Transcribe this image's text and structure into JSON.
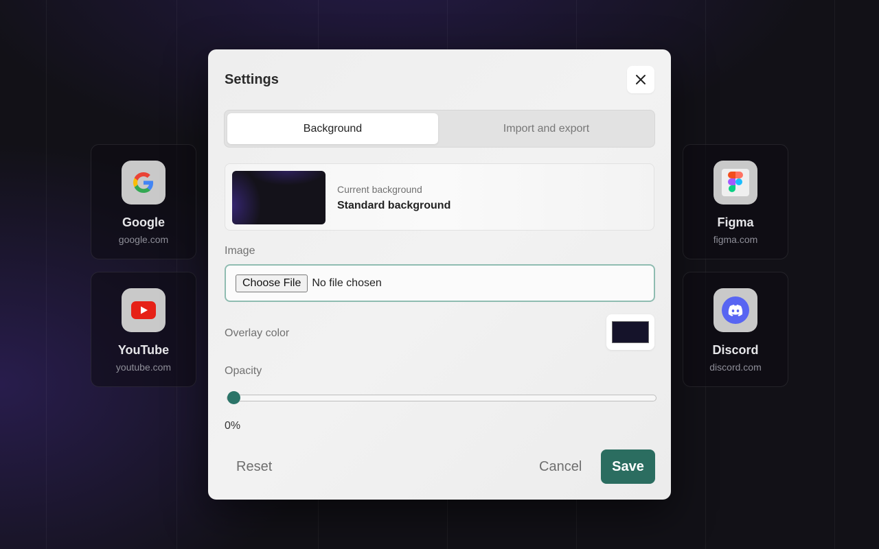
{
  "shortcuts": [
    {
      "name": "Google",
      "url": "google.com",
      "icon": "google-icon"
    },
    {
      "name": "YouTube",
      "url": "youtube.com",
      "icon": "youtube-icon"
    },
    {
      "name": "Figma",
      "url": "figma.com",
      "icon": "figma-icon"
    },
    {
      "name": "Discord",
      "url": "discord.com",
      "icon": "discord-icon"
    }
  ],
  "dialog": {
    "title": "Settings",
    "tabs": [
      {
        "label": "Background",
        "active": true
      },
      {
        "label": "Import and export",
        "active": false
      }
    ],
    "current_background": {
      "label": "Current background",
      "value": "Standard background"
    },
    "image": {
      "label": "Image",
      "button_label": "Choose File",
      "status": "No file chosen"
    },
    "overlay": {
      "label": "Overlay color",
      "color": "#15132a"
    },
    "opacity": {
      "label": "Opacity",
      "value": 0,
      "display": "0%"
    },
    "buttons": {
      "reset": "Reset",
      "cancel": "Cancel",
      "save": "Save"
    }
  },
  "colors": {
    "accent": "#2b6d60",
    "page_background": "#121117"
  }
}
